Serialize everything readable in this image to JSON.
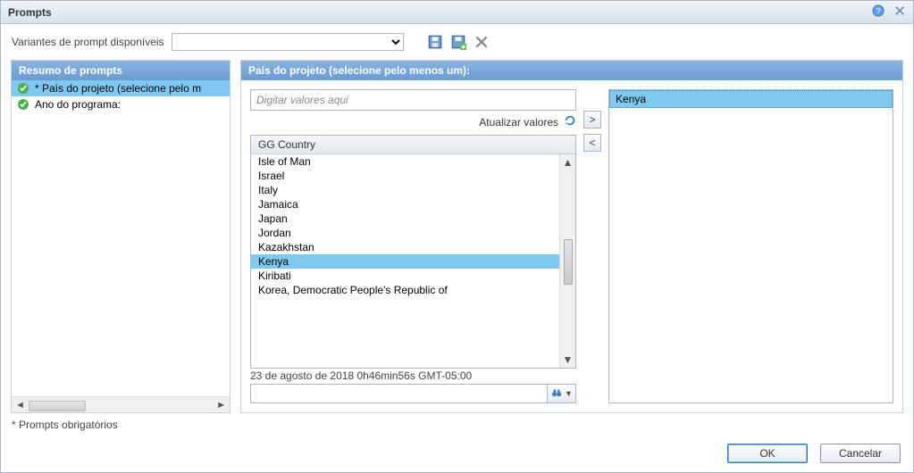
{
  "window": {
    "title": "Prompts"
  },
  "toolbar": {
    "variants_label": "Variantes de prompt disponíveis",
    "variants_value": ""
  },
  "left": {
    "header": "Resumo de prompts",
    "items": [
      {
        "label": "* País do projeto (selecione pelo m",
        "selected": true
      },
      {
        "label": "Ano do programa:",
        "selected": false
      }
    ]
  },
  "right": {
    "header": "País do projeto (selecione pelo menos um):",
    "type_placeholder": "Digitar valores aqui",
    "type_value": "",
    "refresh_label": "Atualizar valores",
    "list_header": "GG Country",
    "countries": [
      "Isle of Man",
      "Israel",
      "Italy",
      "Jamaica",
      "Japan",
      "Jordan",
      "Kazakhstan",
      "Kenya",
      "Kiribati",
      "Korea, Democratic People's Republic of"
    ],
    "selected_in_list": "Kenya",
    "timestamp": "23 de agosto de 2018 0h46min56s GMT-05:00",
    "search_value": "",
    "selected": [
      "Kenya"
    ],
    "move_add": ">",
    "move_remove": "<"
  },
  "footnote": "* Prompts obrigatórios",
  "buttons": {
    "ok": "OK",
    "cancel": "Cancelar"
  }
}
